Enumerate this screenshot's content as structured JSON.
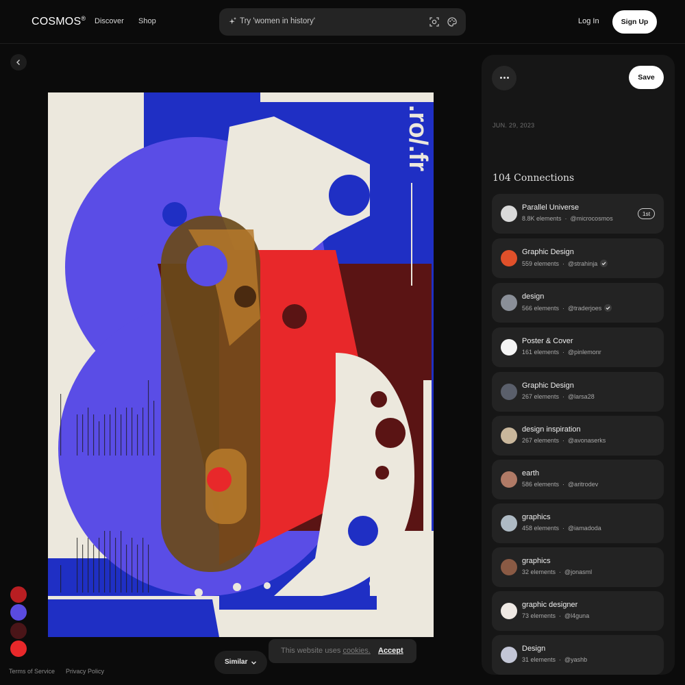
{
  "header": {
    "logo": "COSMOS",
    "logo_mark": "®",
    "nav": [
      "Discover",
      "Shop"
    ],
    "search_placeholder": "Try 'women in history'",
    "search_icons": [
      "sparkle-icon",
      "visual-search-icon",
      "palette-icon"
    ],
    "login": "Log In",
    "signup": "Sign Up"
  },
  "artwork": {
    "alt": "Poster with overlapping blue, red and brown shapes and white gear cutouts",
    "vertical_text": ".ro/.fr"
  },
  "palette": [
    "#b81e22",
    "#5a4be0",
    "#4a1518",
    "#e8282a"
  ],
  "footer": {
    "terms": "Terms of Service",
    "privacy": "Privacy Policy",
    "similar": "Similar"
  },
  "cookie": {
    "prefix": "This website uses ",
    "link": "cookies.",
    "accept": "Accept"
  },
  "panel": {
    "save": "Save",
    "date": "JUN. 29, 2023",
    "connections_title": "104 Connections",
    "connections": [
      {
        "name": "Parallel Universe",
        "count": "8.8K elements",
        "user": "@microcosmos",
        "verified": false,
        "tag": "1st",
        "avatar_color": "#d9d9d9"
      },
      {
        "name": "Graphic Design",
        "count": "559 elements",
        "user": "@strahinja",
        "verified": true,
        "tag": "",
        "avatar_color": "#e0502a"
      },
      {
        "name": "design",
        "count": "566 elements",
        "user": "@traderjoes",
        "verified": true,
        "tag": "",
        "avatar_color": "#8a8f98"
      },
      {
        "name": "Poster & Cover",
        "count": "161 elements",
        "user": "@pinlemonr",
        "verified": false,
        "tag": "",
        "avatar_color": "#f4f4f4"
      },
      {
        "name": "Graphic Design",
        "count": "267 elements",
        "user": "@larsa28",
        "verified": false,
        "tag": "",
        "avatar_color": "#5a5f6b"
      },
      {
        "name": "design inspiration",
        "count": "267 elements",
        "user": "@avonaserks",
        "verified": false,
        "tag": "",
        "avatar_color": "#c9b79c"
      },
      {
        "name": "earth",
        "count": "586 elements",
        "user": "@aritrodev",
        "verified": false,
        "tag": "",
        "avatar_color": "#b07a66"
      },
      {
        "name": "graphics",
        "count": "458 elements",
        "user": "@iamadoda",
        "verified": false,
        "tag": "",
        "avatar_color": "#aebac4"
      },
      {
        "name": "graphics",
        "count": "32 elements",
        "user": "@jonasml",
        "verified": false,
        "tag": "",
        "avatar_color": "#8a5a44"
      },
      {
        "name": "graphic designer",
        "count": "73 elements",
        "user": "@l4guna",
        "verified": false,
        "tag": "",
        "avatar_color": "#efe9e4"
      },
      {
        "name": "Design",
        "count": "31 elements",
        "user": "@yashb",
        "verified": false,
        "tag": "",
        "avatar_color": "#c3c6d6"
      }
    ]
  }
}
